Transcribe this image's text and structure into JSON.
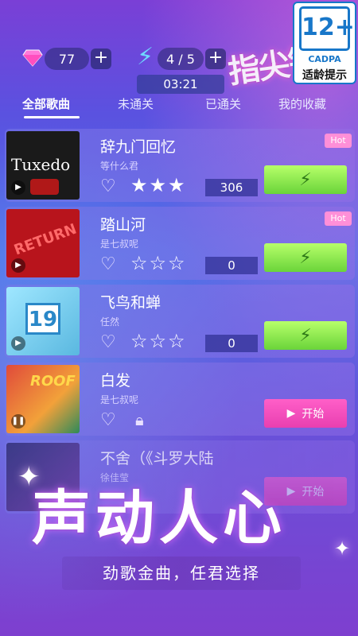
{
  "header": {
    "gems": "77",
    "energy": "4 / 5",
    "timer": "03:21",
    "deco_title": "指尖钢琴"
  },
  "age_badge": {
    "rating": "12+",
    "org": "CADPA",
    "label": "适龄提示"
  },
  "tabs": [
    {
      "label": "全部歌曲",
      "active": true
    },
    {
      "label": "未通关",
      "active": false
    },
    {
      "label": "已通关",
      "active": false
    },
    {
      "label": "我的收藏",
      "active": false
    }
  ],
  "songs": [
    {
      "title": "辞九门回忆",
      "artist": "等什么君",
      "stars": "★★★",
      "score": "306",
      "hot": "Hot",
      "state": "go",
      "cover_text": "Tuxedo"
    },
    {
      "title": "踏山河",
      "artist": "是七叔呢",
      "stars": "☆☆☆",
      "score": "0",
      "hot": "Hot",
      "state": "go",
      "cover_text": "RETURN"
    },
    {
      "title": "飞鸟和蝉",
      "artist": "任然",
      "stars": "☆☆☆",
      "score": "0",
      "hot": "",
      "state": "go",
      "cover_text": "19"
    },
    {
      "title": "白发",
      "artist": "是七叔呢",
      "stars": "",
      "score": "",
      "hot": "",
      "state": "locked",
      "start_label": "开始",
      "cover_text": "ROOF"
    },
    {
      "title": "不舍（《斗罗大陆",
      "artist": "徐佳莹",
      "stars": "",
      "score": "",
      "hot": "",
      "state": "locked",
      "start_label": "开始",
      "cover_text": ""
    }
  ],
  "promo": {
    "headline": "声动人心",
    "subline": "劲歌金曲，任君选择"
  },
  "colors": {
    "go_button": "#8fe84e",
    "start_button": "#f04fbd",
    "hot_badge": "#ff8fd8",
    "accent": "#6ed8ff"
  }
}
